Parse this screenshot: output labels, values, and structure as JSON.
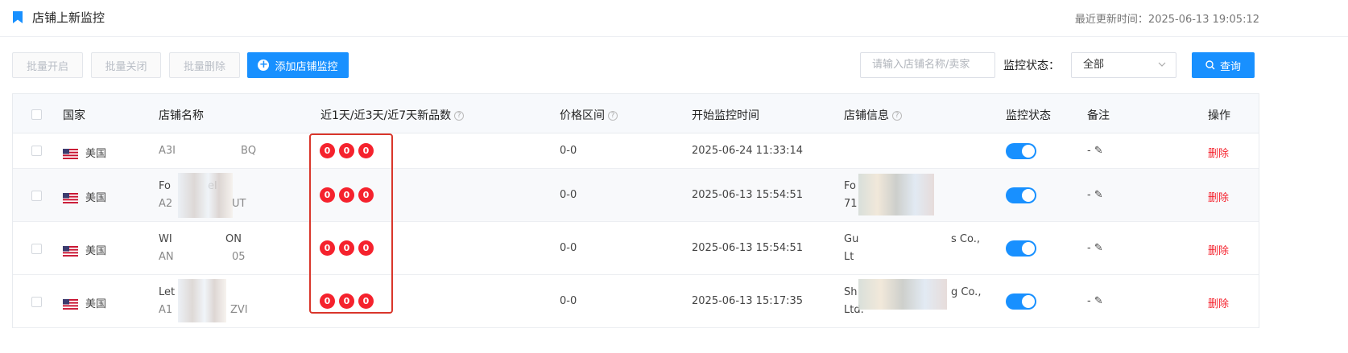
{
  "header": {
    "title": "店铺上新监控",
    "updated_label": "最近更新时间：",
    "updated_time": "2025-06-13 19:05:12"
  },
  "toolbar": {
    "batch_open": "批量开启",
    "batch_close": "批量关闭",
    "batch_delete": "批量删除",
    "add_monitor": "添加店铺监控",
    "search_placeholder": "请输入店铺名称/卖家",
    "status_label": "监控状态：",
    "status_value": "全部",
    "query": "查询"
  },
  "columns": {
    "country": "国家",
    "shop_name": "店铺名称",
    "new_counts": "近1天/近3天/近7天新品数",
    "price_range": "价格区间",
    "start_time": "开始监控时间",
    "shop_info": "店铺信息",
    "monitor_status": "监控状态",
    "remark": "备注",
    "action": "操作"
  },
  "rows": [
    {
      "country": "美国",
      "name1": "A3I",
      "name2": "BQ",
      "counts": [
        "0",
        "0",
        "0"
      ],
      "price": "0-0",
      "time": "2025-06-24 11:33:14",
      "remark": "-",
      "action": "删除"
    },
    {
      "country": "美国",
      "name1": "Fo",
      "name1b": "el",
      "name2": "A2",
      "name2b": "UT",
      "counts": [
        "0",
        "0",
        "0"
      ],
      "price": "0-0",
      "time": "2025-06-13 15:54:51",
      "info1": "Fo",
      "info2": "71",
      "remark": "-",
      "action": "删除"
    },
    {
      "country": "美国",
      "name1": "WI",
      "name1b": "ON",
      "name2": "AN",
      "name2b": "05",
      "counts": [
        "0",
        "0",
        "0"
      ],
      "price": "0-0",
      "time": "2025-06-13 15:54:51",
      "info1": "Gu",
      "info1b": "s Co.,",
      "info2": "Lt",
      "remark": "-",
      "action": "删除"
    },
    {
      "country": "美国",
      "name1": "Let",
      "name2": "A1",
      "name2b": "ZVI",
      "counts": [
        "0",
        "0",
        "0"
      ],
      "price": "0-0",
      "time": "2025-06-13 15:17:35",
      "info1": "Sh",
      "info1b": "g Co.,",
      "info2": "Ltd.",
      "remark": "-",
      "action": "删除"
    }
  ]
}
